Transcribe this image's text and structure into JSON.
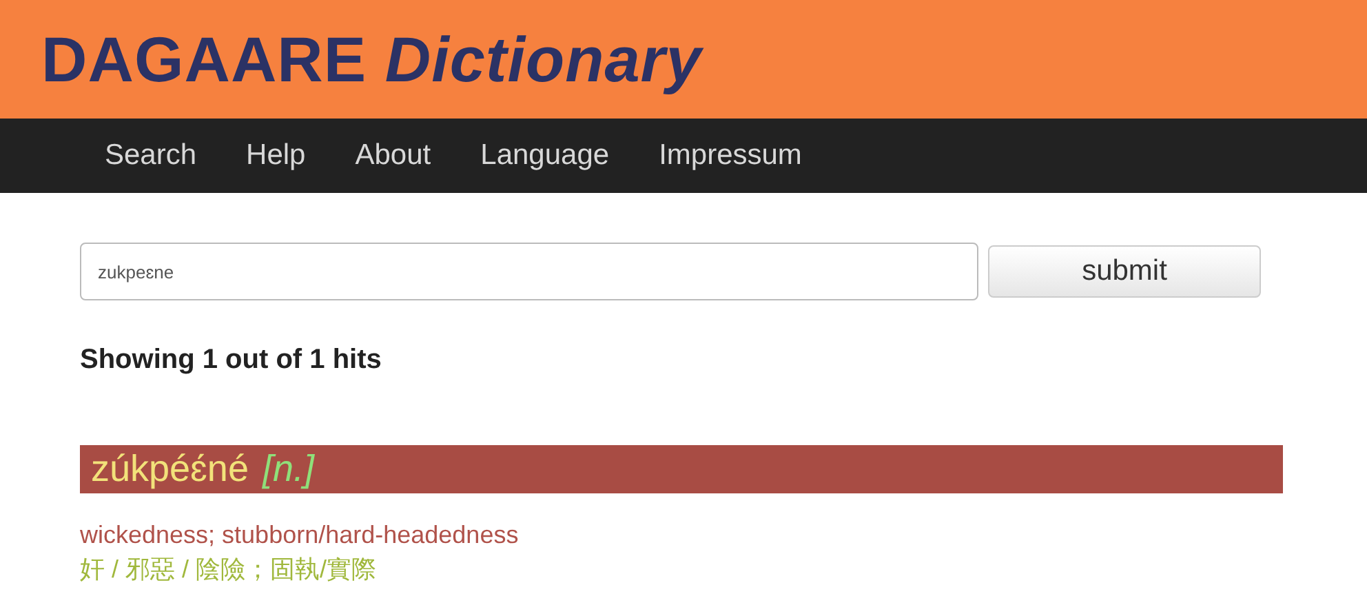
{
  "header": {
    "title_plain": "DAGAARE",
    "title_italic": "Dictionary"
  },
  "nav": [
    {
      "label": "Search"
    },
    {
      "label": "Help"
    },
    {
      "label": "About"
    },
    {
      "label": "Language"
    },
    {
      "label": "Impressum"
    }
  ],
  "search": {
    "value": "zukpeɛne",
    "button": "submit"
  },
  "results_summary": "Showing 1 out of 1 hits",
  "entries": [
    {
      "headword": "zúkpéɛ́né",
      "pos": "[n.]",
      "definition": "wickedness; stubborn/hard-headedness",
      "translation": "奸 / 邪惡 / 陰險；固執/實際"
    }
  ]
}
